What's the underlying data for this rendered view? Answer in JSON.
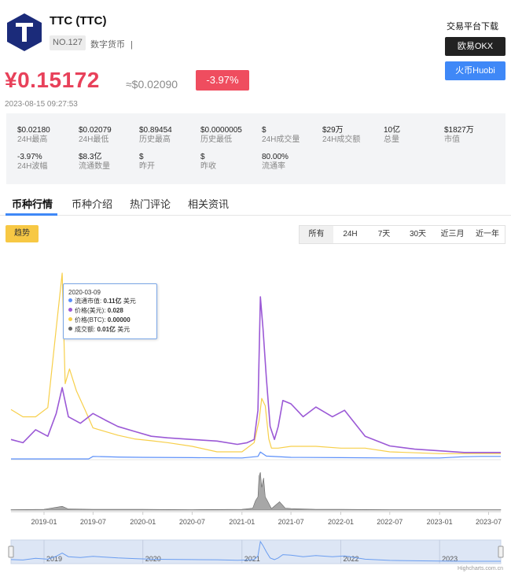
{
  "coin": {
    "name": "TTC (TTC)",
    "rank": "NO.127",
    "category": "数字货币",
    "separator": "|",
    "logo_letter": "T",
    "logo_color": "#1b2b7a"
  },
  "download": {
    "title": "交易平台下载",
    "okx_label": "欧易OKX",
    "huobi_label": "火币Huobi"
  },
  "price": {
    "cny": "¥0.15172",
    "usd": "≈$0.02090",
    "change": "-3.97%",
    "timestamp": "2023-08-15 09:27:53"
  },
  "stats": [
    {
      "value": "$0.02180",
      "label": "24H最高"
    },
    {
      "value": "$0.02079",
      "label": "24H最低"
    },
    {
      "value": "$0.89454",
      "label": "历史最高"
    },
    {
      "value": "$0.0000005",
      "label": "历史最低"
    },
    {
      "value": "$",
      "label": "24H成交量"
    },
    {
      "value": "$29万",
      "label": "24H成交额"
    },
    {
      "value": "10亿",
      "label": "总量"
    },
    {
      "value": "$1827万",
      "label": "市值"
    },
    {
      "value": "-3.97%",
      "label": "24H波幅"
    },
    {
      "value": "$8.3亿",
      "label": "流通数量"
    },
    {
      "value": "$",
      "label": "昨开"
    },
    {
      "value": "$",
      "label": "昨收"
    },
    {
      "value": "80.00%",
      "label": "流通率"
    }
  ],
  "tabs": [
    "币种行情",
    "币种介绍",
    "热门评论",
    "相关资讯"
  ],
  "trend_label": "趋势",
  "ranges": [
    "所有",
    "24H",
    "7天",
    "30天",
    "近三月",
    "近一年"
  ],
  "tooltip": {
    "date": "2020-03-09",
    "rows": [
      {
        "name": "流通市值",
        "value": "0.11亿",
        "unit": "美元",
        "color": "#5b8ff9"
      },
      {
        "name": "价格(美元)",
        "value": "0.028",
        "unit": "",
        "color": "#9b59d6"
      },
      {
        "name": "价格(BTC)",
        "value": "0.00000",
        "unit": "",
        "color": "#f7cf4a"
      },
      {
        "name": "成交额",
        "value": "0.01亿",
        "unit": "美元",
        "color": "#666666"
      }
    ]
  },
  "credit": "Highcharts.com.cn",
  "chart_data": {
    "type": "line",
    "x_ticks": [
      "2019-01",
      "2019-07",
      "2020-01",
      "2020-07",
      "2021-01",
      "2021-07",
      "2022-01",
      "2022-07",
      "2023-01",
      "2023-07"
    ],
    "navigator_ticks": [
      "2019",
      "2020",
      "2021",
      "2022",
      "2023"
    ],
    "x_domain": [
      "2018-09-01",
      "2023-08-15"
    ],
    "y_axis_labels": "none",
    "series": [
      {
        "name": "价格(美元)",
        "color": "#9b59d6",
        "x": [
          "2018-09-01",
          "2018-10-15",
          "2018-12-01",
          "2019-01-15",
          "2019-02-15",
          "2019-03-09",
          "2019-04-01",
          "2019-05-15",
          "2019-07-01",
          "2019-08-15",
          "2019-10-01",
          "2019-12-01",
          "2020-02-01",
          "2020-04-01",
          "2020-07-01",
          "2020-10-01",
          "2020-12-15",
          "2021-01-20",
          "2021-02-15",
          "2021-03-01",
          "2021-03-10",
          "2021-03-20",
          "2021-04-01",
          "2021-04-15",
          "2021-05-01",
          "2021-05-15",
          "2021-06-01",
          "2021-07-01",
          "2021-08-15",
          "2021-10-01",
          "2021-12-01",
          "2022-01-15",
          "2022-04-01",
          "2022-07-01",
          "2022-10-01",
          "2023-01-01",
          "2023-04-01",
          "2023-08-15"
        ],
        "values": [
          0.12,
          0.1,
          0.18,
          0.14,
          0.28,
          0.44,
          0.26,
          0.22,
          0.28,
          0.24,
          0.2,
          0.17,
          0.14,
          0.13,
          0.12,
          0.11,
          0.09,
          0.1,
          0.12,
          0.3,
          1.0,
          0.8,
          0.5,
          0.2,
          0.12,
          0.2,
          0.36,
          0.34,
          0.26,
          0.32,
          0.26,
          0.3,
          0.14,
          0.08,
          0.06,
          0.05,
          0.04,
          0.04
        ]
      },
      {
        "name": "价格(BTC)",
        "color": "#f7cf4a",
        "x": [
          "2018-09-01",
          "2018-10-15",
          "2018-12-01",
          "2019-01-15",
          "2019-02-15",
          "2019-03-09",
          "2019-03-20",
          "2019-04-05",
          "2019-05-01",
          "2019-06-01",
          "2019-07-01",
          "2019-08-15",
          "2019-10-01",
          "2019-12-01",
          "2020-02-01",
          "2020-04-01",
          "2020-07-01",
          "2020-10-01",
          "2021-01-01",
          "2021-02-15",
          "2021-03-05",
          "2021-03-15",
          "2021-03-28",
          "2021-04-10",
          "2021-04-20",
          "2021-05-15",
          "2021-07-01",
          "2021-10-01",
          "2022-01-01",
          "2022-04-01",
          "2022-07-01",
          "2023-01-01",
          "2023-08-15"
        ],
        "values": [
          0.26,
          0.22,
          0.22,
          0.27,
          0.7,
          1.0,
          0.4,
          0.48,
          0.36,
          0.26,
          0.16,
          0.14,
          0.12,
          0.1,
          0.09,
          0.08,
          0.06,
          0.03,
          0.03,
          0.08,
          0.2,
          0.32,
          0.28,
          0.1,
          0.05,
          0.05,
          0.06,
          0.06,
          0.05,
          0.05,
          0.03,
          0.02,
          0.02
        ]
      },
      {
        "name": "流通市值",
        "color": "#5b8ff9",
        "x": [
          "2018-09-01",
          "2019-06-15",
          "2019-07-01",
          "2019-10-01",
          "2020-01-01",
          "2020-07-01",
          "2021-01-01",
          "2021-03-01",
          "2021-03-10",
          "2021-04-01",
          "2021-07-01",
          "2022-01-01",
          "2022-07-01",
          "2023-01-01",
          "2023-04-01",
          "2023-06-01",
          "2023-08-15"
        ],
        "values": [
          0.0,
          0.0,
          0.08,
          0.06,
          0.05,
          0.04,
          0.03,
          0.08,
          0.22,
          0.09,
          0.05,
          0.04,
          0.03,
          0.03,
          0.07,
          0.08,
          0.08
        ]
      },
      {
        "name": "成交额",
        "color": "#666666",
        "x": [
          "2018-09-01",
          "2019-01-01",
          "2019-03-09",
          "2019-04-01",
          "2019-07-01",
          "2020-01-01",
          "2020-07-01",
          "2021-01-01",
          "2021-02-10",
          "2021-02-20",
          "2021-03-01",
          "2021-03-05",
          "2021-03-10",
          "2021-03-15",
          "2021-03-22",
          "2021-03-28",
          "2021-04-05",
          "2021-04-20",
          "2021-05-20",
          "2021-06-10",
          "2021-07-01",
          "2021-10-01",
          "2022-01-01",
          "2022-07-01",
          "2023-01-01",
          "2023-08-15"
        ],
        "values": [
          0.01,
          0.02,
          0.1,
          0.03,
          0.02,
          0.02,
          0.01,
          0.02,
          0.05,
          0.25,
          0.35,
          0.9,
          1.0,
          0.6,
          0.85,
          0.35,
          0.25,
          0.04,
          0.22,
          0.05,
          0.04,
          0.02,
          0.02,
          0.01,
          0.01,
          0.01
        ]
      }
    ]
  }
}
